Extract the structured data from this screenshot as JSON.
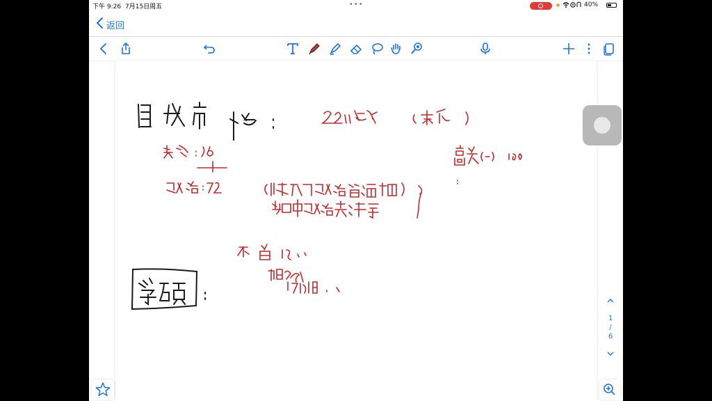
{
  "status_bar": {
    "time": "下午 9:26",
    "date": "7月15日周五",
    "battery": "40%",
    "recording_color": "#e53935"
  },
  "nav": {
    "back_label": "返回"
  },
  "toolbar": {
    "icons": [
      "chevron-left-icon",
      "share-icon",
      "undo-icon",
      "text-tool-icon",
      "pen-icon",
      "highlighter-icon",
      "eraser-icon",
      "lasso-icon",
      "hand-icon",
      "laser-pointer-icon",
      "microphone-icon",
      "add-icon",
      "more-icon",
      "pages-icon"
    ],
    "accent": "#1a73e8",
    "pen_color": "#d32f2f"
  },
  "pager": {
    "current": "1",
    "separator": "/",
    "total": "6"
  },
  "note": {
    "ink_colors": {
      "black": "#1a1a1a",
      "red": "#c62828"
    }
  }
}
